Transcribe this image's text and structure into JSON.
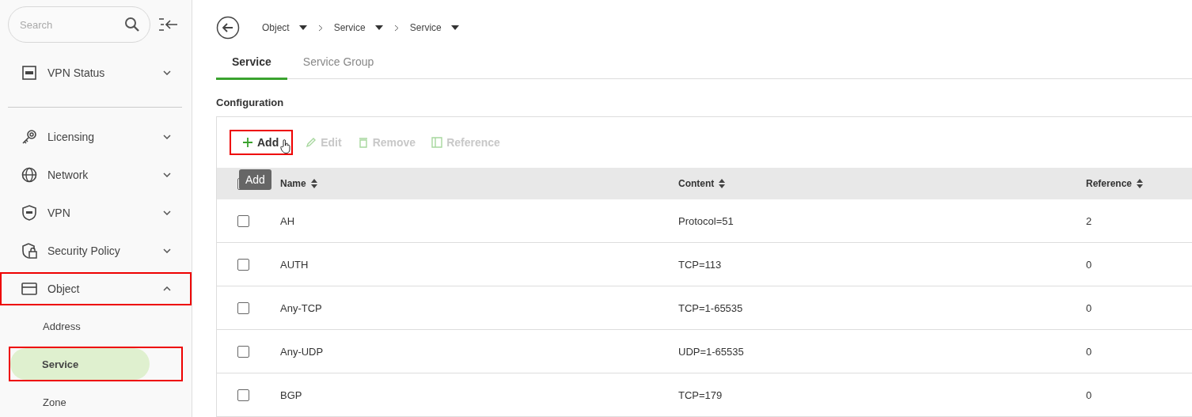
{
  "sidebar": {
    "search": {
      "placeholder": "Search"
    },
    "groups": [
      [
        {
          "label": "VPN Status",
          "expanded": false,
          "highlighted": false
        }
      ],
      [
        {
          "label": "Licensing",
          "expanded": false,
          "highlighted": false
        },
        {
          "label": "Network",
          "expanded": false,
          "highlighted": false
        },
        {
          "label": "VPN",
          "expanded": false,
          "highlighted": false
        },
        {
          "label": "Security Policy",
          "expanded": false,
          "highlighted": false
        },
        {
          "label": "Object",
          "expanded": true,
          "highlighted": true,
          "children": [
            {
              "label": "Address",
              "selected": false,
              "highlighted": false
            },
            {
              "label": "Service",
              "selected": true,
              "highlighted": true
            },
            {
              "label": "Zone",
              "selected": false,
              "highlighted": false
            }
          ]
        }
      ]
    ]
  },
  "breadcrumb": [
    "Object",
    "Service",
    "Service"
  ],
  "tabs": [
    {
      "label": "Service",
      "selected": true
    },
    {
      "label": "Service Group",
      "selected": false
    }
  ],
  "section_title": "Configuration",
  "toolbar": [
    {
      "label": "Add",
      "disabled": false,
      "highlighted": true,
      "tooltip": "Add"
    },
    {
      "label": "Edit",
      "disabled": true,
      "highlighted": false
    },
    {
      "label": "Remove",
      "disabled": true,
      "highlighted": false
    },
    {
      "label": "Reference",
      "disabled": true,
      "highlighted": false
    }
  ],
  "table": {
    "select_all": {
      "checked": false
    },
    "columns": [
      "Name",
      "Content",
      "Reference"
    ],
    "rows": [
      {
        "checked": false,
        "cells": [
          "AH",
          "Protocol=51",
          "2"
        ]
      },
      {
        "checked": false,
        "cells": [
          "AUTH",
          "TCP=113",
          "0"
        ]
      },
      {
        "checked": false,
        "cells": [
          "Any-TCP",
          "TCP=1-65535",
          "0"
        ]
      },
      {
        "checked": false,
        "cells": [
          "Any-UDP",
          "UDP=1-65535",
          "0"
        ]
      },
      {
        "checked": false,
        "cells": [
          "BGP",
          "TCP=179",
          "0"
        ]
      }
    ]
  }
}
